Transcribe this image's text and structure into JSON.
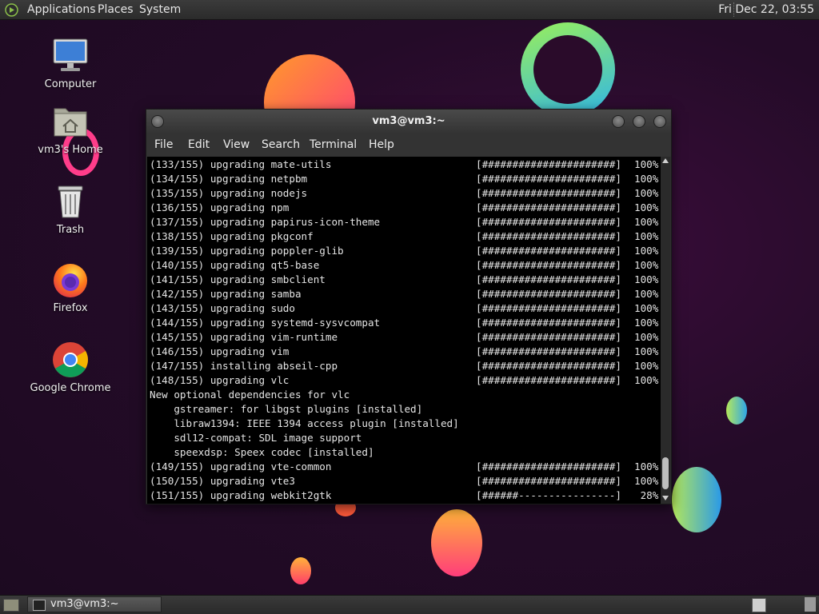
{
  "top_panel": {
    "menus": [
      "Applications",
      "Places",
      "System"
    ],
    "clock": "Fri Dec 22, 03:55"
  },
  "desktop_icons": [
    {
      "label": "Computer",
      "icon": "computer-icon"
    },
    {
      "label": "vm3's Home",
      "icon": "home-folder-icon"
    },
    {
      "label": "Trash",
      "icon": "trash-icon"
    },
    {
      "label": "Firefox",
      "icon": "firefox-icon"
    },
    {
      "label": "Google Chrome",
      "icon": "chrome-icon"
    }
  ],
  "window": {
    "title": "vm3@vm3:~",
    "menu": [
      "File",
      "Edit",
      "View",
      "Search",
      "Terminal",
      "Help"
    ]
  },
  "terminal": {
    "lines": [
      {
        "text": "(133/155) upgrading mate-utils",
        "bar": "[######################]",
        "pct": "100%"
      },
      {
        "text": "(134/155) upgrading netpbm",
        "bar": "[######################]",
        "pct": "100%"
      },
      {
        "text": "(135/155) upgrading nodejs",
        "bar": "[######################]",
        "pct": "100%"
      },
      {
        "text": "(136/155) upgrading npm",
        "bar": "[######################]",
        "pct": "100%"
      },
      {
        "text": "(137/155) upgrading papirus-icon-theme",
        "bar": "[######################]",
        "pct": "100%"
      },
      {
        "text": "(138/155) upgrading pkgconf",
        "bar": "[######################]",
        "pct": "100%"
      },
      {
        "text": "(139/155) upgrading poppler-glib",
        "bar": "[######################]",
        "pct": "100%"
      },
      {
        "text": "(140/155) upgrading qt5-base",
        "bar": "[######################]",
        "pct": "100%"
      },
      {
        "text": "(141/155) upgrading smbclient",
        "bar": "[######################]",
        "pct": "100%"
      },
      {
        "text": "(142/155) upgrading samba",
        "bar": "[######################]",
        "pct": "100%"
      },
      {
        "text": "(143/155) upgrading sudo",
        "bar": "[######################]",
        "pct": "100%"
      },
      {
        "text": "(144/155) upgrading systemd-sysvcompat",
        "bar": "[######################]",
        "pct": "100%"
      },
      {
        "text": "(145/155) upgrading vim-runtime",
        "bar": "[######################]",
        "pct": "100%"
      },
      {
        "text": "(146/155) upgrading vim",
        "bar": "[######################]",
        "pct": "100%"
      },
      {
        "text": "(147/155) installing abseil-cpp",
        "bar": "[######################]",
        "pct": "100%"
      },
      {
        "text": "(148/155) upgrading vlc",
        "bar": "[######################]",
        "pct": "100%"
      },
      {
        "text": "New optional dependencies for vlc",
        "bar": "",
        "pct": ""
      },
      {
        "text": "    gstreamer: for libgst plugins [installed]",
        "bar": "",
        "pct": ""
      },
      {
        "text": "    libraw1394: IEEE 1394 access plugin [installed]",
        "bar": "",
        "pct": ""
      },
      {
        "text": "    sdl12-compat: SDL image support",
        "bar": "",
        "pct": ""
      },
      {
        "text": "    speexdsp: Speex codec [installed]",
        "bar": "",
        "pct": ""
      },
      {
        "text": "(149/155) upgrading vte-common",
        "bar": "[######################]",
        "pct": "100%"
      },
      {
        "text": "(150/155) upgrading vte3",
        "bar": "[######################]",
        "pct": "100%"
      },
      {
        "text": "(151/155) upgrading webkit2gtk",
        "bar": "[######----------------]",
        "pct": " 28%"
      }
    ]
  },
  "taskbar": {
    "task_label": "vm3@vm3:~"
  }
}
